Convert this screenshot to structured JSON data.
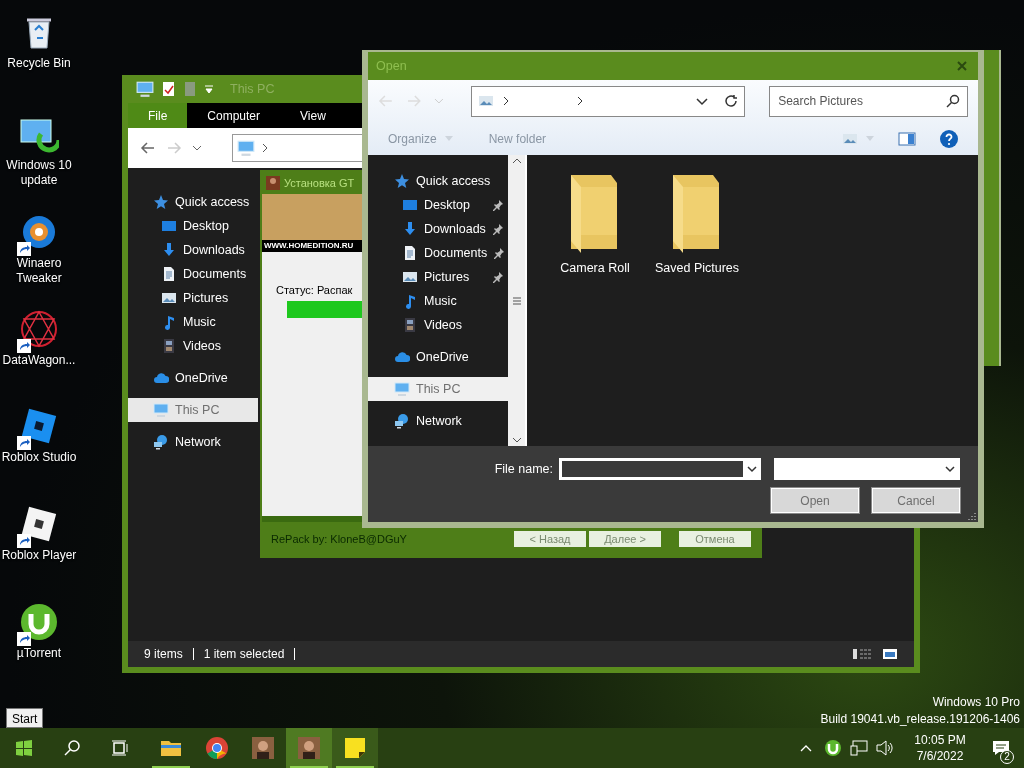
{
  "desktop_icons": [
    {
      "label": "Recycle Bin",
      "shortcut": false
    },
    {
      "label": "Windows 10 update",
      "shortcut": false
    },
    {
      "label": "Winaero Tweaker",
      "shortcut": true
    },
    {
      "label": "DataWagon...",
      "shortcut": true
    },
    {
      "label": "Roblox Studio",
      "shortcut": true
    },
    {
      "label": "Roblox Player",
      "shortcut": true
    },
    {
      "label": "µTorrent",
      "shortcut": true
    }
  ],
  "explorer": {
    "title": "This PC",
    "ribbon_tabs": [
      {
        "label": "File",
        "selected": true
      },
      {
        "label": "Computer",
        "selected": false
      },
      {
        "label": "View",
        "selected": false
      }
    ],
    "nav": [
      {
        "label": "Quick access",
        "selected": false,
        "children": [
          {
            "label": "Desktop",
            "selected": false
          },
          {
            "label": "Downloads",
            "selected": false
          },
          {
            "label": "Documents",
            "selected": false
          },
          {
            "label": "Pictures",
            "selected": false
          },
          {
            "label": "Music",
            "selected": false
          },
          {
            "label": "Videos",
            "selected": false
          }
        ]
      },
      {
        "label": "OneDrive",
        "selected": false
      },
      {
        "label": "This PC",
        "selected": true
      },
      {
        "label": "Network",
        "selected": false
      }
    ],
    "status": [
      "9 items",
      "1 item selected"
    ]
  },
  "installer": {
    "title": "Установка GT",
    "banner_text": "WWW.HOMEDITION.RU",
    "status": "Статус: Распак",
    "level": 0.3,
    "footer": "RePack by: KloneB@DGuY",
    "buttons": [
      "< Назад",
      "Далее >",
      "Отмена"
    ]
  },
  "dialog": {
    "title": "Open",
    "search_placeholder": "Search Pictures",
    "toolbar": [
      "Organize",
      "New folder"
    ],
    "nav": [
      {
        "label": "Quick access",
        "selected": false,
        "children": [
          {
            "label": "Desktop",
            "selected": false,
            "pinned": true
          },
          {
            "label": "Downloads",
            "selected": false,
            "pinned": true
          },
          {
            "label": "Documents",
            "selected": false,
            "pinned": true
          },
          {
            "label": "Pictures",
            "selected": false,
            "pinned": true
          },
          {
            "label": "Music",
            "selected": false,
            "pinned": false
          },
          {
            "label": "Videos",
            "selected": false,
            "pinned": false
          }
        ]
      },
      {
        "label": "OneDrive",
        "selected": false
      },
      {
        "label": "This PC",
        "selected": true
      },
      {
        "label": "Network",
        "selected": false
      }
    ],
    "folders": [
      "Camera Roll",
      "Saved Pictures"
    ],
    "file_name_label": "File name:",
    "buttons": [
      "Open",
      "Cancel"
    ]
  },
  "tooltip": "Start",
  "watermark": [
    "Windows 10 Pro",
    "Build 19041.vb_release.191206-1406"
  ],
  "taskbar": {
    "apps": [
      {
        "selected": false,
        "running": true
      },
      {
        "selected": false,
        "running": false
      },
      {
        "selected": false,
        "running": false
      },
      {
        "selected": true,
        "running": true
      },
      {
        "selected": false,
        "running": true
      }
    ],
    "time": "10:05 PM",
    "date": "7/6/2022",
    "notifications": "2"
  }
}
